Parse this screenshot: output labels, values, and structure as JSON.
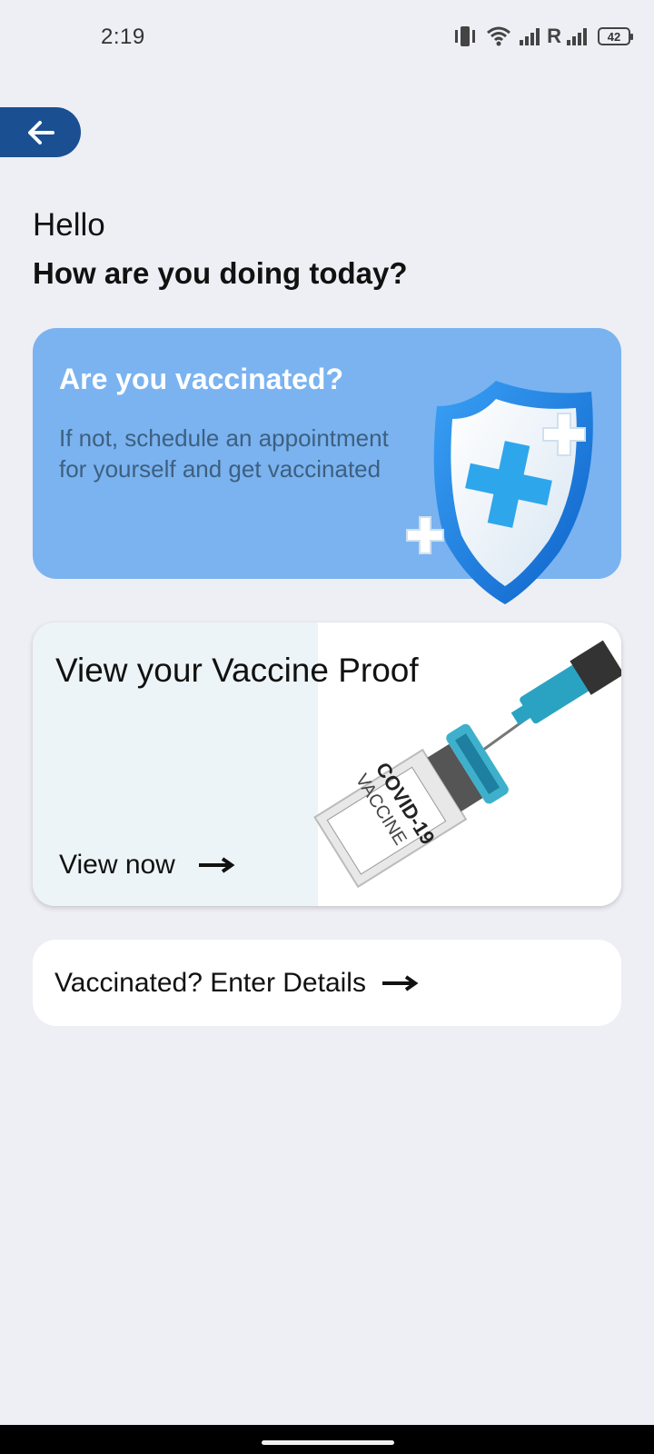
{
  "status_bar": {
    "time": "2:19",
    "roaming_label": "R",
    "battery_level": "42",
    "icons": [
      "vibrate-icon",
      "wifi-icon",
      "signal-icon",
      "signal-icon"
    ]
  },
  "back_button": {
    "icon": "arrow-left-icon"
  },
  "greeting": {
    "hello": "Hello",
    "question": "How are you doing today?"
  },
  "vaccination_card": {
    "title": "Are you vaccinated?",
    "description": "If not, schedule an appointment for yourself and get vaccinated",
    "illustration": "shield-plus-icon",
    "background_color": "#7ab3f0"
  },
  "proof_card": {
    "title": "View your Vaccine Proof",
    "link_label": "View now",
    "illustration": "covid-vaccine-syringe",
    "vial_label_line1": "COVID-19",
    "vial_label_line2": "VACCINE"
  },
  "details_card": {
    "label": "Vaccinated? Enter Details"
  },
  "colors": {
    "background": "#eeeef5",
    "accent": "#1a4f92",
    "card_blue": "#7ab3f0"
  }
}
